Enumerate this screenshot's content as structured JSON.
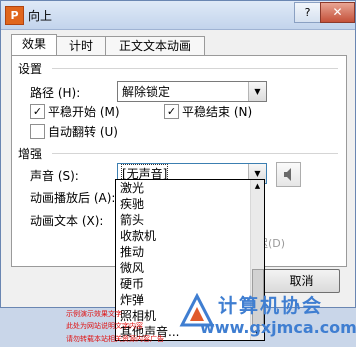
{
  "window": {
    "title": "向上",
    "app_icon_letter": "P",
    "help": "?",
    "close": "✕"
  },
  "tabs": [
    {
      "label": "效果"
    },
    {
      "label": "计时"
    },
    {
      "label": "正文文本动画"
    }
  ],
  "settings": {
    "group": "设置",
    "path_label": "路径 (H):",
    "path_value": "解除锁定",
    "smooth_start": {
      "label": "平稳开始 (M)",
      "checked": true
    },
    "smooth_end": {
      "label": "平稳结束 (N)",
      "checked": true
    },
    "auto_reverse": {
      "label": "自动翻转 (U)",
      "checked": false
    }
  },
  "enhance": {
    "group": "增强",
    "sound_label": "声音 (S):",
    "sound_value": "[无声音]",
    "after_anim_label": "动画播放后 (A):",
    "anim_text_label": "动画文本 (X):",
    "ghost_text": "迟(D)"
  },
  "sound_options": [
    "激光",
    "疾驰",
    "箭头",
    "收款机",
    "推动",
    "微风",
    "硬币",
    "炸弹",
    "照相机",
    "其他声音..."
  ],
  "buttons": {
    "cancel": "取消"
  },
  "watermark": {
    "brand": "计算机协会",
    "url": "www.gxjmca.com"
  },
  "red_lines": [
    "示例演示效果文字",
    "此处为网站说明文字内容",
    "请勿转载本站相关资源内容广告"
  ]
}
